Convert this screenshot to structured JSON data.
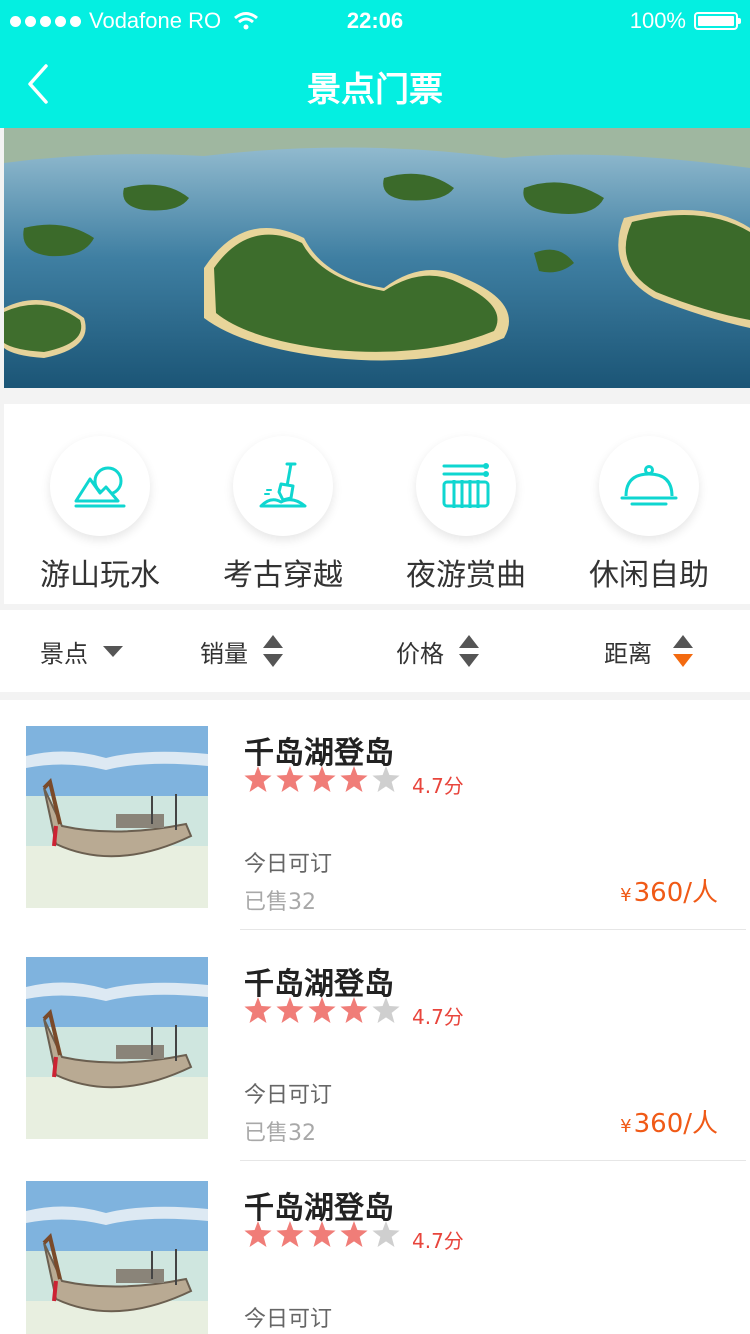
{
  "status_bar": {
    "carrier": "Vodafone RO",
    "time": "22:06",
    "battery": "100%"
  },
  "nav": {
    "title": "景点门票"
  },
  "categories": [
    {
      "label": "游山玩水",
      "icon": "mountain-icon"
    },
    {
      "label": "考古穿越",
      "icon": "shovel-icon"
    },
    {
      "label": "夜游赏曲",
      "icon": "xylophone-icon"
    },
    {
      "label": "休闲自助",
      "icon": "food-cloche-icon"
    }
  ],
  "sort": {
    "spot": "景点",
    "sales": "销量",
    "price": "价格",
    "distance": "距离",
    "active_color": "#f36a10"
  },
  "items": [
    {
      "title": "千岛湖登岛",
      "rating": "4.7分",
      "stars": 4,
      "availability": "今日可订",
      "sold": "已售32",
      "price_symbol": "¥",
      "price": "360/人"
    },
    {
      "title": "千岛湖登岛",
      "rating": "4.7分",
      "stars": 4,
      "availability": "今日可订",
      "sold": "已售32",
      "price_symbol": "¥",
      "price": "360/人"
    },
    {
      "title": "千岛湖登岛",
      "rating": "4.7分",
      "stars": 4,
      "availability": "今日可订",
      "sold": "",
      "price_symbol": "",
      "price": ""
    }
  ],
  "colors": {
    "primary": "#04efe1",
    "price": "#f05a17",
    "rating": "#e8453c",
    "star": "#f07d78",
    "star_off": "#cfcfcf"
  }
}
